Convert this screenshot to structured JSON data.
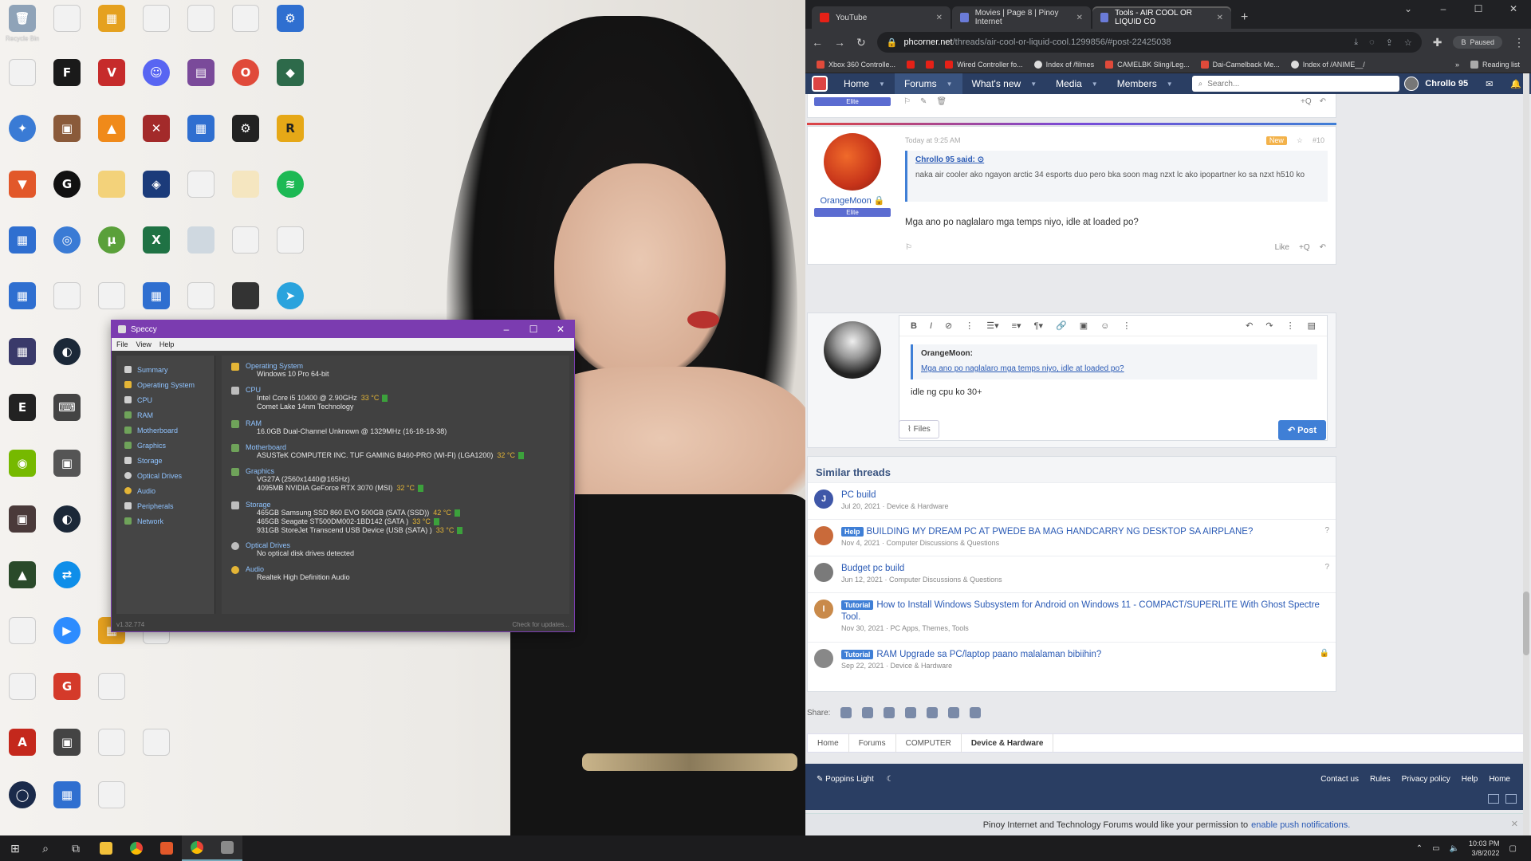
{
  "desktop": {
    "icons": [
      {
        "label": "Recycle Bin",
        "glyph": "🗑",
        "color": "#8fa3b8"
      },
      {
        "label": "",
        "glyph": "",
        "color": "#f2f2f2"
      },
      {
        "label": "",
        "glyph": "▦",
        "color": "#e5a11f"
      },
      {
        "label": "",
        "glyph": "",
        "color": "#f2f2f2"
      },
      {
        "label": "",
        "glyph": "",
        "color": "#f2f2f2"
      },
      {
        "label": "",
        "glyph": "",
        "color": "#f2f2f2"
      },
      {
        "label": "",
        "glyph": "⚙",
        "color": "#2f6fd0"
      },
      {
        "label": "",
        "glyph": "",
        "color": "#f2f2f2"
      },
      {
        "label": "",
        "glyph": "F",
        "color": "#1a1a1a"
      },
      {
        "label": "",
        "glyph": "V",
        "color": "#c62b2b"
      },
      {
        "label": "",
        "glyph": "☺",
        "color": "#5865f2"
      },
      {
        "label": "",
        "glyph": "▤",
        "color": "#7a4a9a"
      },
      {
        "label": "",
        "glyph": "O",
        "color": "#e04a3a"
      },
      {
        "label": "",
        "glyph": "◆",
        "color": "#2d6a4a"
      }
    ],
    "speccy_ref": "Speccy"
  },
  "speccy": {
    "title": "Speccy",
    "menu": [
      "File",
      "View",
      "Help"
    ],
    "sidebar": [
      "Summary",
      "Operating System",
      "CPU",
      "RAM",
      "Motherboard",
      "Graphics",
      "Storage",
      "Optical Drives",
      "Audio",
      "Peripherals",
      "Network"
    ],
    "os": {
      "head": "Operating System",
      "l1": "Windows 10 Pro 64-bit"
    },
    "cpu": {
      "head": "CPU",
      "l1": "Intel Core i5 10400 @ 2.90GHz",
      "temp": "33 °C",
      "l2": "Comet Lake 14nm Technology"
    },
    "ram": {
      "head": "RAM",
      "l1": "16.0GB Dual-Channel Unknown @ 1329MHz (16-18-18-38)"
    },
    "mobo": {
      "head": "Motherboard",
      "l1": "ASUSTeK COMPUTER INC. TUF GAMING B460-PRO (WI-FI) (LGA1200)",
      "temp": "32 °C"
    },
    "gpu": {
      "head": "Graphics",
      "l1": "VG27A (2560x1440@165Hz)",
      "l2": "4095MB NVIDIA GeForce RTX 3070 (MSI)",
      "temp": "32 °C"
    },
    "storage": {
      "head": "Storage",
      "d1": "465GB Samsung SSD 860 EVO 500GB (SATA (SSD))",
      "t1": "42 °C",
      "d2": "465GB Seagate ST500DM002-1BD142 (SATA )",
      "t2": "33 °C",
      "d3": "931GB StoreJet Transcend USB Device (USB (SATA) )",
      "t3": "33 °C"
    },
    "optical": {
      "head": "Optical Drives",
      "l1": "No optical disk drives detected"
    },
    "audio": {
      "head": "Audio",
      "l1": "Realtek High Definition Audio"
    },
    "version": "v1.32.774",
    "update": "Check for updates..."
  },
  "browser": {
    "tabs": [
      {
        "title": "YouTube",
        "color": "#e62117"
      },
      {
        "title": "Movies | Page 8 | Pinoy Internet",
        "color": "#6a7bd8"
      },
      {
        "title": "Tools - AIR COOL OR LIQUID CO",
        "color": "#6a7bd8"
      }
    ],
    "url_domain": "phcorner.net",
    "url_path": "/threads/air-cool-or-liquid-cool.1299856/#post-22425038",
    "paused": "Paused",
    "profile_initial": "B",
    "bookmarks": [
      {
        "label": "Xbox 360 Controlle...",
        "color": "#e04a3a"
      },
      {
        "label": "",
        "color": "#e62117"
      },
      {
        "label": "",
        "color": "#e62117"
      },
      {
        "label": "Wired Controller fo...",
        "color": "#e62117"
      },
      {
        "label": "Index of /filmes",
        "color": "#ddd"
      },
      {
        "label": "CAMELBK Sling/Leg...",
        "color": "#e04a3a"
      },
      {
        "label": "Dai-Camelback Me...",
        "color": "#e04a3a"
      },
      {
        "label": "Index of /ANIME__/",
        "color": "#ddd"
      }
    ],
    "reading_list": "Reading list"
  },
  "forum": {
    "nav": [
      "Home",
      "Forums",
      "What's new",
      "Media",
      "Members"
    ],
    "search_placeholder": "Search...",
    "user": "Chrollo 95",
    "prev_badge": "Elite",
    "post": {
      "time": "Today at 9:25 AM",
      "new": "New",
      "num": "#10",
      "author": "OrangeMoon",
      "badge": "Elite",
      "quote_author": "Chrollo 95 said:",
      "quote_text": "naka air cooler ako ngayon arctic 34 esports duo pero bka soon mag nzxt lc ako ipopartner ko sa nzxt h510 ko",
      "body": "Mga ano po naglalaro mga temps niyo, idle at loaded po?",
      "like": "Like",
      "quote_btn": "+Q"
    },
    "reply": {
      "quote_author": "OrangeMoon:",
      "quote_text": "Mga ano po naglalaro mga temps niyo, idle at loaded po?",
      "text": "idle ng cpu ko 30+",
      "files": "Files",
      "post": "Post"
    },
    "similar_title": "Similar threads",
    "threads": [
      {
        "prefix": "",
        "title": "PC build",
        "meta": "Jul 20, 2021 · Device & Hardware",
        "av": "J",
        "color": "#3f57a8",
        "icon": ""
      },
      {
        "prefix": "Help",
        "title": "BUILDING MY DREAM PC AT PWEDE BA MAG HANDCARRY NG DESKTOP SA AIRPLANE?",
        "meta": "Nov 4, 2021 · Computer Discussions & Questions",
        "av": "",
        "color": "#c96a3a",
        "icon": "?"
      },
      {
        "prefix": "",
        "title": "Budget pc build",
        "meta": "Jun 12, 2021 · Computer Discussions & Questions",
        "av": "",
        "color": "#7a7a7a",
        "icon": "?"
      },
      {
        "prefix": "Tutorial",
        "title": "How to Install Windows Subsystem for Android on Windows 11 - COMPACT/SUPERLITE With Ghost Spectre Tool.",
        "meta": "Nov 30, 2021 · PC Apps, Themes, Tools",
        "av": "I",
        "color": "#c98a4a",
        "icon": ""
      },
      {
        "prefix": "Tutorial",
        "title": "RAM Upgrade sa PC/laptop paano malalaman bibiihin?",
        "meta": "Sep 22, 2021 · Device & Hardware",
        "av": "",
        "color": "#888",
        "icon": "🔒"
      }
    ],
    "share_label": "Share:",
    "breadcrumbs": [
      "Home",
      "Forums",
      "COMPUTER",
      "Device & Hardware"
    ],
    "footer_style": "Poppins Light",
    "footer_links": [
      "Contact us",
      "Rules",
      "Privacy policy",
      "Help",
      "Home"
    ],
    "push_text": "Pinoy Internet and Technology Forums would like your permission to",
    "push_link": "enable push notifications."
  },
  "taskbar": {
    "time": "10:03 PM",
    "date": "3/8/2022"
  }
}
